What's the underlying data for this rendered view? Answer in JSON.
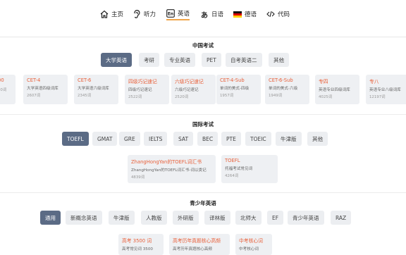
{
  "nav": {
    "items": [
      {
        "label": "主页",
        "icon": "home-icon"
      },
      {
        "label": "听力",
        "icon": "ear-icon"
      },
      {
        "label": "英语",
        "icon": "english-en-icon"
      },
      {
        "label": "日语",
        "icon": "japanese-hiragana-icon"
      },
      {
        "label": "德语",
        "icon": "german-flag-icon"
      },
      {
        "label": "代码",
        "icon": "code-icon"
      }
    ],
    "active": "英语",
    "accent": "#f0a54a"
  },
  "china": {
    "title": "中国考试",
    "tabs": [
      "大学英语",
      "考研",
      "专业英语",
      "PET",
      "自考英语二",
      "其他"
    ],
    "active_tab": "大学英语",
    "cards": [
      {
        "title": "",
        "desc": "",
        "count": ""
      },
      {
        "title": "CET-4",
        "desc": "大学英语四级词库",
        "count": "2607词"
      },
      {
        "title": "CET-6",
        "desc": "大学英语六级词库",
        "count": "2345词"
      },
      {
        "title": "四级巧记速记",
        "desc": "四级巧记速记",
        "count": "2522词"
      },
      {
        "title": "六级巧记速记",
        "desc": "六级巧记速记",
        "count": "2520词"
      },
      {
        "title": "CET-4-Sub",
        "desc": "单词的美式-四级",
        "count": "1957词"
      },
      {
        "title": "CET-6-Sub",
        "desc": "单词的美式-六级",
        "count": "1949词"
      },
      {
        "title": "专四",
        "desc": "英语专业四级词库",
        "count": "4025词"
      },
      {
        "title": "专八",
        "desc": "英语专业八级词库",
        "count": "12197词"
      }
    ],
    "partial_left": {
      "title": "00",
      "desc": "",
      "count": "00词"
    }
  },
  "intl": {
    "title": "国际考试",
    "tabs": [
      "TOEFL",
      "GMAT",
      "GRE",
      "IELTS",
      "SAT",
      "BEC",
      "PTE",
      "TOEIC",
      "牛津版",
      "其他"
    ],
    "active_tab": "TOEFL",
    "cards": [
      {
        "title": "ZhangHongYan的TOEFL词汇书",
        "desc": "ZhangHongYan的TOEFL词汇书-词以类记",
        "count": "4839词"
      },
      {
        "title": "TOEFL",
        "desc": "托福考试常见词",
        "count": "4264词"
      }
    ]
  },
  "youth": {
    "title": "青少年英语",
    "tabs": [
      "通用",
      "新概念英语",
      "牛津版",
      "人教版",
      "外研版",
      "译林版",
      "北师大",
      "EF",
      "青少年英语",
      "RAZ"
    ],
    "active_tab": "通用",
    "cards": [
      {
        "title": "高考 3500 词",
        "desc": "高考常见词 3500",
        "count": ""
      },
      {
        "title": "高考历年真题核心高频",
        "desc": "高考历年真题核心高频",
        "count": ""
      },
      {
        "title": "中考核心词",
        "desc": "中考核心词",
        "count": ""
      }
    ]
  }
}
